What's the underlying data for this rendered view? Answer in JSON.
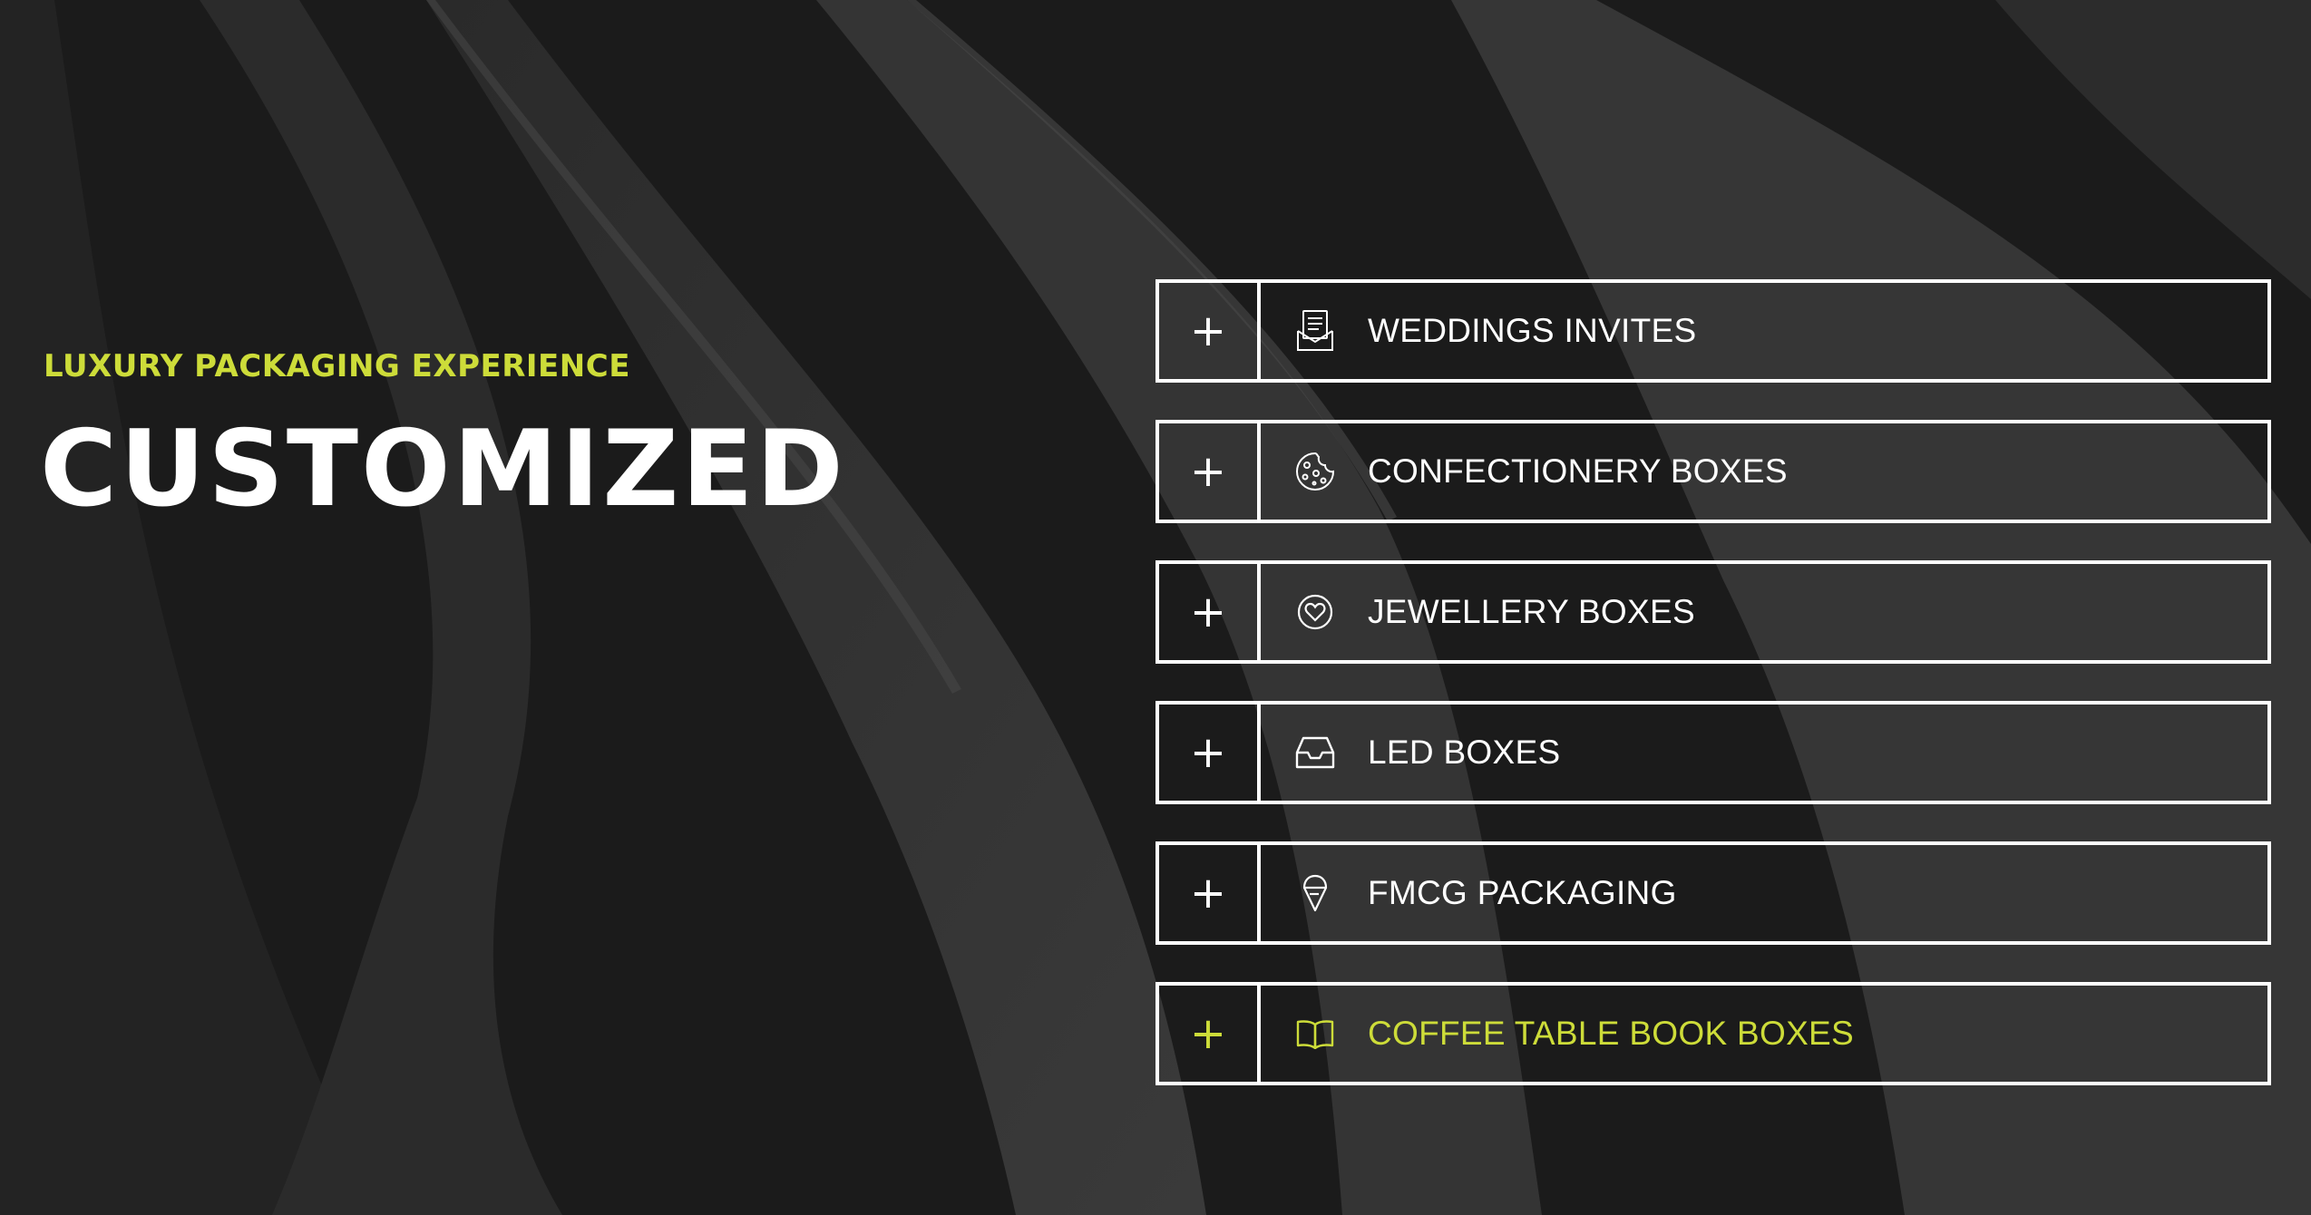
{
  "colors": {
    "accent": "#cddc39",
    "text": "#ffffff",
    "background": "#1c1c1c"
  },
  "hero": {
    "eyebrow": "LUXURY PACKAGING EXPERIENCE",
    "headline": "CUSTOMIZED"
  },
  "accordion": {
    "toggle_symbol": "+",
    "items": [
      {
        "label": "WEDDINGS INVITES",
        "icon": "invitation-icon",
        "active": false
      },
      {
        "label": "CONFECTIONERY BOXES",
        "icon": "cookie-icon",
        "active": false
      },
      {
        "label": "JEWELLERY BOXES",
        "icon": "heart-ring-icon",
        "active": false
      },
      {
        "label": "LED BOXES",
        "icon": "inbox-tray-icon",
        "active": false
      },
      {
        "label": "FMCG PACKAGING",
        "icon": "ice-cream-icon",
        "active": false
      },
      {
        "label": "COFFEE TABLE BOOK BOXES",
        "icon": "open-book-icon",
        "active": true
      }
    ]
  }
}
